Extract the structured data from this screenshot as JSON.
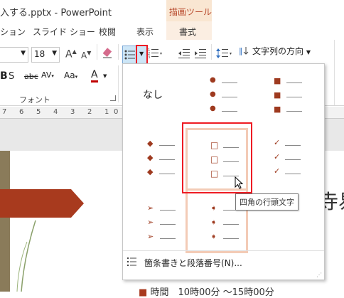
{
  "window": {
    "title": "入する.pptx - PowerPoint",
    "context_tab_header": "描画ツール"
  },
  "tabs": {
    "items": [
      "ション",
      "スライド ショー",
      "校閲",
      "表示"
    ],
    "context_tab": "書式"
  },
  "ribbon": {
    "font_size": "18",
    "paragraph_direction": "文字列の方向",
    "font_group_label": "フォント",
    "bold_icon": "B",
    "strike_icon": "abc",
    "spacing_icon": "AV",
    "case_icon": "Aa",
    "font_color_icon": "A",
    "grow_icon": "A",
    "shrink_icon": "A"
  },
  "ruler": {
    "numbers": [
      "7",
      "6",
      "5",
      "4",
      "3",
      "2",
      "1",
      "0"
    ]
  },
  "bullet_gallery": {
    "none_label": "なし",
    "tooltip": "四角の行頭文字",
    "footer_label": "箇条書きと段落番号(N)...",
    "accent_color": "#9e3a1f",
    "check_color": "#9e3a1f",
    "styles": [
      {
        "name": "none"
      },
      {
        "name": "filled-round",
        "glyph": "●"
      },
      {
        "name": "filled-square",
        "glyph": "■"
      },
      {
        "name": "filled-diamond",
        "glyph": "◆"
      },
      {
        "name": "hollow-square",
        "glyph": "□"
      },
      {
        "name": "checkmark",
        "glyph": "✓"
      },
      {
        "name": "arrow",
        "glyph": "➢"
      },
      {
        "name": "tag",
        "glyph": "➧"
      }
    ]
  },
  "slide": {
    "partial_text_right": "寺易",
    "bottom_text": "時間　10時00分 ～15時00分"
  },
  "colors": {
    "ribbon_context": "#f9e6d2",
    "annotation_red": "#ee1c24",
    "slide_arrow": "#a83a1e",
    "highlight_cell": "#f3cbb6"
  }
}
